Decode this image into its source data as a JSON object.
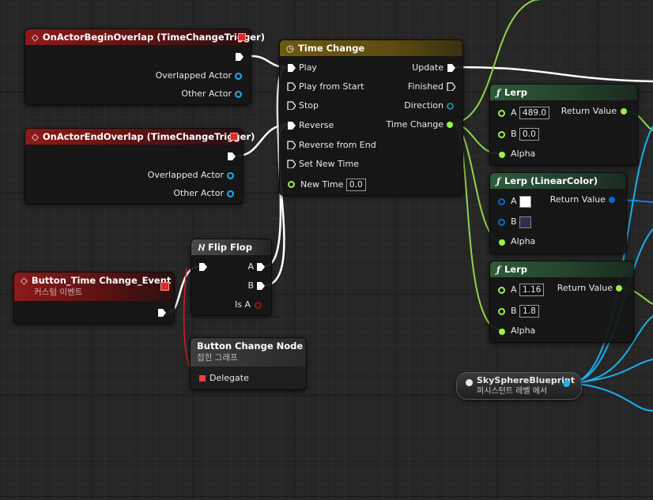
{
  "begin_overlap": {
    "title": "OnActorBeginOverlap (TimeChangeTrigger)",
    "pin1": "Overlapped Actor",
    "pin2": "Other Actor"
  },
  "end_overlap": {
    "title": "OnActorEndOverlap (TimeChangeTrigger)",
    "pin1": "Overlapped Actor",
    "pin2": "Other Actor"
  },
  "timeline": {
    "title": "Time Change",
    "play": "Play",
    "play_from_start": "Play from Start",
    "stop": "Stop",
    "reverse": "Reverse",
    "reverse_from_end": "Reverse from End",
    "set_new_time": "Set New Time",
    "new_time": "New Time",
    "new_time_value": "0.0",
    "update": "Update",
    "finished": "Finished",
    "direction": "Direction",
    "time_change": "Time Change"
  },
  "lerp1": {
    "title": "Lerp",
    "a": "A",
    "a_value": "489.0",
    "b": "B",
    "b_value": "0.0",
    "alpha": "Alpha",
    "ret": "Return Value"
  },
  "lerp_color": {
    "title": "Lerp (LinearColor)",
    "a": "A",
    "b": "B",
    "alpha": "Alpha",
    "ret": "Return Value",
    "a_color": "#ffffff",
    "b_color": "#2a2f50"
  },
  "lerp2": {
    "title": "Lerp",
    "a": "A",
    "a_value": "1.16",
    "b": "B",
    "b_value": "1.8",
    "alpha": "Alpha",
    "ret": "Return Value"
  },
  "custom_event": {
    "title": "Button_Time Change_Event",
    "subtitle": "커스텀 이벤트"
  },
  "flipflop": {
    "title": "Flip Flop",
    "a": "A",
    "b": "B",
    "is_a": "Is A"
  },
  "collapsed": {
    "title": "Button Change Node",
    "subtitle": "접힌 그래프",
    "delegate": "Delegate"
  },
  "sky": {
    "title": "SkySphereBlueprint",
    "subtitle": "퍼시스턴트 레벨 에서"
  },
  "colors": {
    "exec": "#ffffff",
    "float": "#9cf04a",
    "object": "#00a8f0",
    "struct": "#0a6ad0",
    "bool": "#a01010",
    "delegate": "#ff3838",
    "teal": "#2ab3b3"
  }
}
